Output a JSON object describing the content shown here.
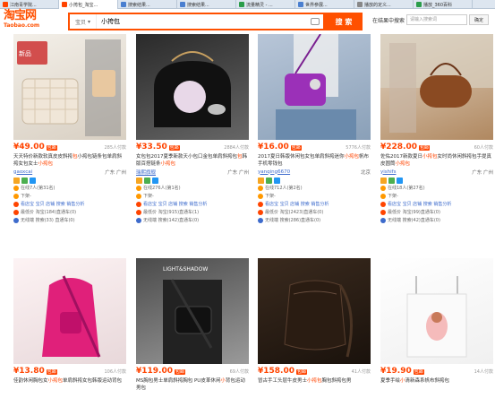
{
  "tabs": [
    {
      "label": "江南青学院..."
    },
    {
      "label": "小挎包_淘宝..."
    },
    {
      "label": "搜索结果..."
    },
    {
      "label": "搜索结果..."
    },
    {
      "label": "流量精灵 - ..."
    },
    {
      "label": "世界参展..."
    },
    {
      "label": "播放的定义..."
    },
    {
      "label": "播放_360百科"
    }
  ],
  "header": {
    "logo_main": "淘宝网",
    "logo_sub": "Taobao.com",
    "search_scope": "宝贝",
    "search_query": "小挎包",
    "search_button": "搜 索",
    "within_label": "在结果中搜索",
    "within_placeholder": "请输入搜索词",
    "within_button": "确定"
  },
  "colors": {
    "accent": "#ff5000",
    "price": "#ff4400",
    "link": "#3d6bcc"
  },
  "products": [
    {
      "price": "¥49.00",
      "tag": "包邮",
      "sold": "285人付款",
      "title_a": "天天特价新款软真皮皮斜挎",
      "title_hl": "包",
      "title_b": "小挎包链条包单肩斜挎女包女士",
      "title_hl2": "小挎包",
      "shop": "gaoxcai",
      "location": "广东 广州",
      "meta1": "在线7人(第31名)",
      "meta2": "下架-",
      "meta3": "看店宝 宝贝 店铺 搜索 销售分析",
      "meta4": "最低价 淘宝(184)直通车(0)",
      "meta5": "无线端 搜索(33) 直通车(0)"
    },
    {
      "price": "¥33.50",
      "tag": "包邮",
      "sold": "2884人付款",
      "title_a": "女包包2017夏季新款天小包口金包单肩斜挎包",
      "title_hl": "包",
      "title_b": "韩版百搭链条",
      "title_hl2": "小挎包",
      "shop": "瑞熙旗舰",
      "location": "广东 广州",
      "meta1": "在线276人(第1名)",
      "meta2": "下架-",
      "meta3": "看店宝 宝贝 店铺 搜索 销售分析",
      "meta4": "最低价 淘宝(915)直通车(1)",
      "meta5": "无线端 搜索(142)直通车(0)"
    },
    {
      "price": "¥16.00",
      "tag": "包邮",
      "sold": "5776人付款",
      "title_a": "2017夏日韩版休闲包女包单肩斜挎迷你",
      "title_hl": "小挎包",
      "title_b": "帆布手机零钱包",
      "title_hl2": "",
      "shop": "yanqing6670",
      "location": "北京",
      "meta1": "在线712人(第2名)",
      "meta2": "下架-",
      "meta3": "看店宝 宝贝 店铺 搜索 销售分析",
      "meta4": "最低价 淘宝(2423)直通车(0)",
      "meta5": "无线端 搜索(286)直通车(0)"
    },
    {
      "price": "¥228.00",
      "tag": "包邮",
      "sold": "60人付款",
      "title_a": "佐佑2017新款夏日",
      "title_hl": "小挎包",
      "title_b": "女时尚休闲斜挎包手提真皮圆筒",
      "title_hl2": "小挎包",
      "shop": "yishifs",
      "location": "广东 广州",
      "meta1": "在线18人(第27名)",
      "meta2": "下架-",
      "meta3": "看店宝 宝贝 店铺 搜索 销售分析",
      "meta4": "最低价 淘宝(99)直通车(0)",
      "meta5": "无线端 搜索(42)直通车(0)"
    },
    {
      "price": "¥13.80",
      "tag": "包邮",
      "sold": "106人付款",
      "title_a": "佳韵休闲胸包女",
      "title_hl": "小挎包",
      "title_b": "单肩斜挎女包韩版运动背包",
      "title_hl2": "",
      "shop": "",
      "location": "",
      "meta1": "",
      "meta2": "",
      "meta3": "",
      "meta4": "",
      "meta5": ""
    },
    {
      "price": "¥119.00",
      "tag": "包邮",
      "sold": "69人付款",
      "title_a": "MS胸包男士单肩斜挎胸包 PU皮革休闲",
      "title_hl": "小",
      "title_b": "背包运动男包",
      "title_hl2": "",
      "shop": "",
      "location": "",
      "meta1": "",
      "meta2": "",
      "meta3": "",
      "meta4": "",
      "meta5": ""
    },
    {
      "price": "¥158.00",
      "tag": "包邮",
      "sold": "41人付款",
      "title_a": "冒古手工头层牛皮男士",
      "title_hl": "小挎包",
      "title_b": "胸包斜挎包男",
      "title_hl2": "",
      "shop": "",
      "location": "",
      "meta1": "",
      "meta2": "",
      "meta3": "",
      "meta4": "",
      "meta5": ""
    },
    {
      "price": "¥19.90",
      "tag": "包邮",
      "sold": "14人付款",
      "title_a": "夏季手绘",
      "title_hl": "小",
      "title_b": "清新森系帆布斜挎包",
      "title_hl2": "",
      "shop": "",
      "location": "",
      "meta1": "",
      "meta2": "",
      "meta3": "",
      "meta4": "",
      "meta5": ""
    }
  ]
}
